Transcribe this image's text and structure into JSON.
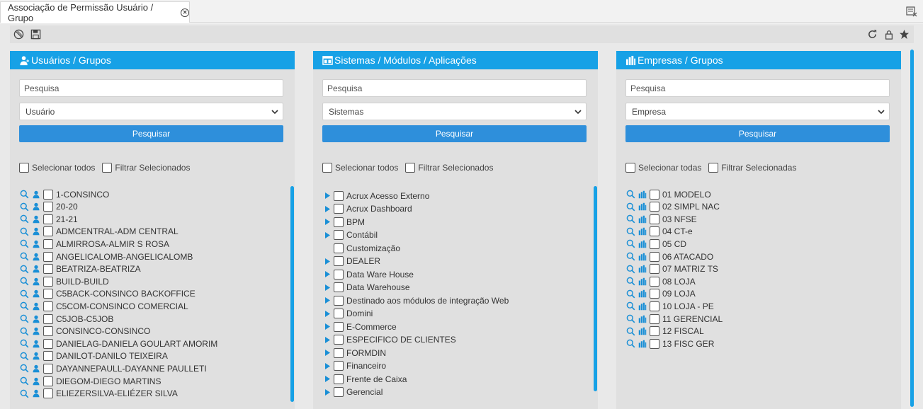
{
  "tab": {
    "title": "Associação de Permissão Usuário / Grupo"
  },
  "toolbar": {
    "left_icons": [
      "cancel-icon",
      "save-icon"
    ],
    "right_icons": [
      "refresh-icon",
      "lock-icon",
      "star-icon"
    ]
  },
  "panels": {
    "users": {
      "title": "Usuários / Grupos",
      "search_placeholder": "Pesquisa",
      "select_value": "Usuário",
      "button": "Pesquisar",
      "select_all": "Selecionar todos",
      "filter_selected": "Filtrar Selecionados",
      "items": [
        "1-CONSINCO",
        "20-20",
        "21-21",
        "ADMCENTRAL-ADM CENTRAL",
        "ALMIRROSA-ALMIR S ROSA",
        "ANGELICALOMB-ANGELICALOMB",
        "BEATRIZA-BEATRIZA",
        "BUILD-BUILD",
        "C5BACK-CONSINCO BACKOFFICE",
        "C5COM-CONSINCO COMERCIAL",
        "C5JOB-C5JOB",
        "CONSINCO-CONSINCO",
        "DANIELAG-DANIELA GOULART AMORIM",
        "DANILOT-DANILO TEIXEIRA",
        "DAYANNEPAULL-DAYANNE PAULLETI",
        "DIEGOM-DIEGO MARTINS",
        "ELIEZERSILVA-ELIÉZER SILVA"
      ]
    },
    "systems": {
      "title": "Sistemas / Módulos / Aplicações",
      "search_placeholder": "Pesquisa",
      "select_value": "Sistemas",
      "button": "Pesquisar",
      "select_all": "Selecionar todos",
      "filter_selected": "Filtrar Selecionados",
      "items": [
        {
          "label": "Acrux Acesso Externo",
          "expandable": true
        },
        {
          "label": "Acrux Dashboard",
          "expandable": true
        },
        {
          "label": "BPM",
          "expandable": true
        },
        {
          "label": "Contábil",
          "expandable": true
        },
        {
          "label": "Customização",
          "expandable": false
        },
        {
          "label": "DEALER",
          "expandable": true
        },
        {
          "label": "Data Ware House",
          "expandable": true
        },
        {
          "label": "Data Warehouse",
          "expandable": true
        },
        {
          "label": "Destinado aos módulos de integração Web",
          "expandable": true
        },
        {
          "label": "Domini",
          "expandable": true
        },
        {
          "label": "E-Commerce",
          "expandable": true
        },
        {
          "label": "ESPECIFICO DE CLIENTES",
          "expandable": true
        },
        {
          "label": "FORMDIN",
          "expandable": true
        },
        {
          "label": "Financeiro",
          "expandable": true
        },
        {
          "label": "Frente de Caixa",
          "expandable": true
        },
        {
          "label": "Gerencial",
          "expandable": true
        }
      ]
    },
    "companies": {
      "title": "Empresas / Grupos",
      "search_placeholder": "Pesquisa",
      "select_value": "Empresa",
      "button": "Pesquisar",
      "select_all": "Selecionar todas",
      "filter_selected": "Filtrar Selecionadas",
      "items": [
        "01 MODELO",
        "02 SIMPL NAC",
        "03 NFSE",
        "04 CT-e",
        "05 CD",
        "06 ATACADO",
        "07 MATRIZ TS",
        "08 LOJA",
        "09 LOJA",
        "10 LOJA - PE",
        "11 GERENCIAL",
        "12 FISCAL",
        "13 FISC GER"
      ]
    }
  }
}
